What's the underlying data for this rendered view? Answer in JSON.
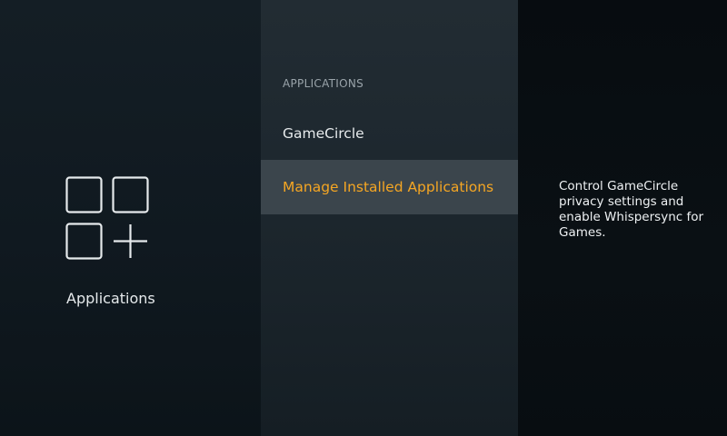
{
  "category": {
    "icon": "apps-grid-plus-icon",
    "label": "Applications"
  },
  "menu": {
    "header": "APPLICATIONS",
    "items": [
      {
        "label": "GameCircle",
        "selected": false
      },
      {
        "label": "Manage Installed Applications",
        "selected": true
      }
    ]
  },
  "description": {
    "text": "Control GameCircle privacy settings and enable Whispersync for Games."
  },
  "colors": {
    "accent": "#f5a623",
    "selected_row": "#3b454c",
    "text": "#e6eaec",
    "header_text": "#9aa4aa"
  }
}
